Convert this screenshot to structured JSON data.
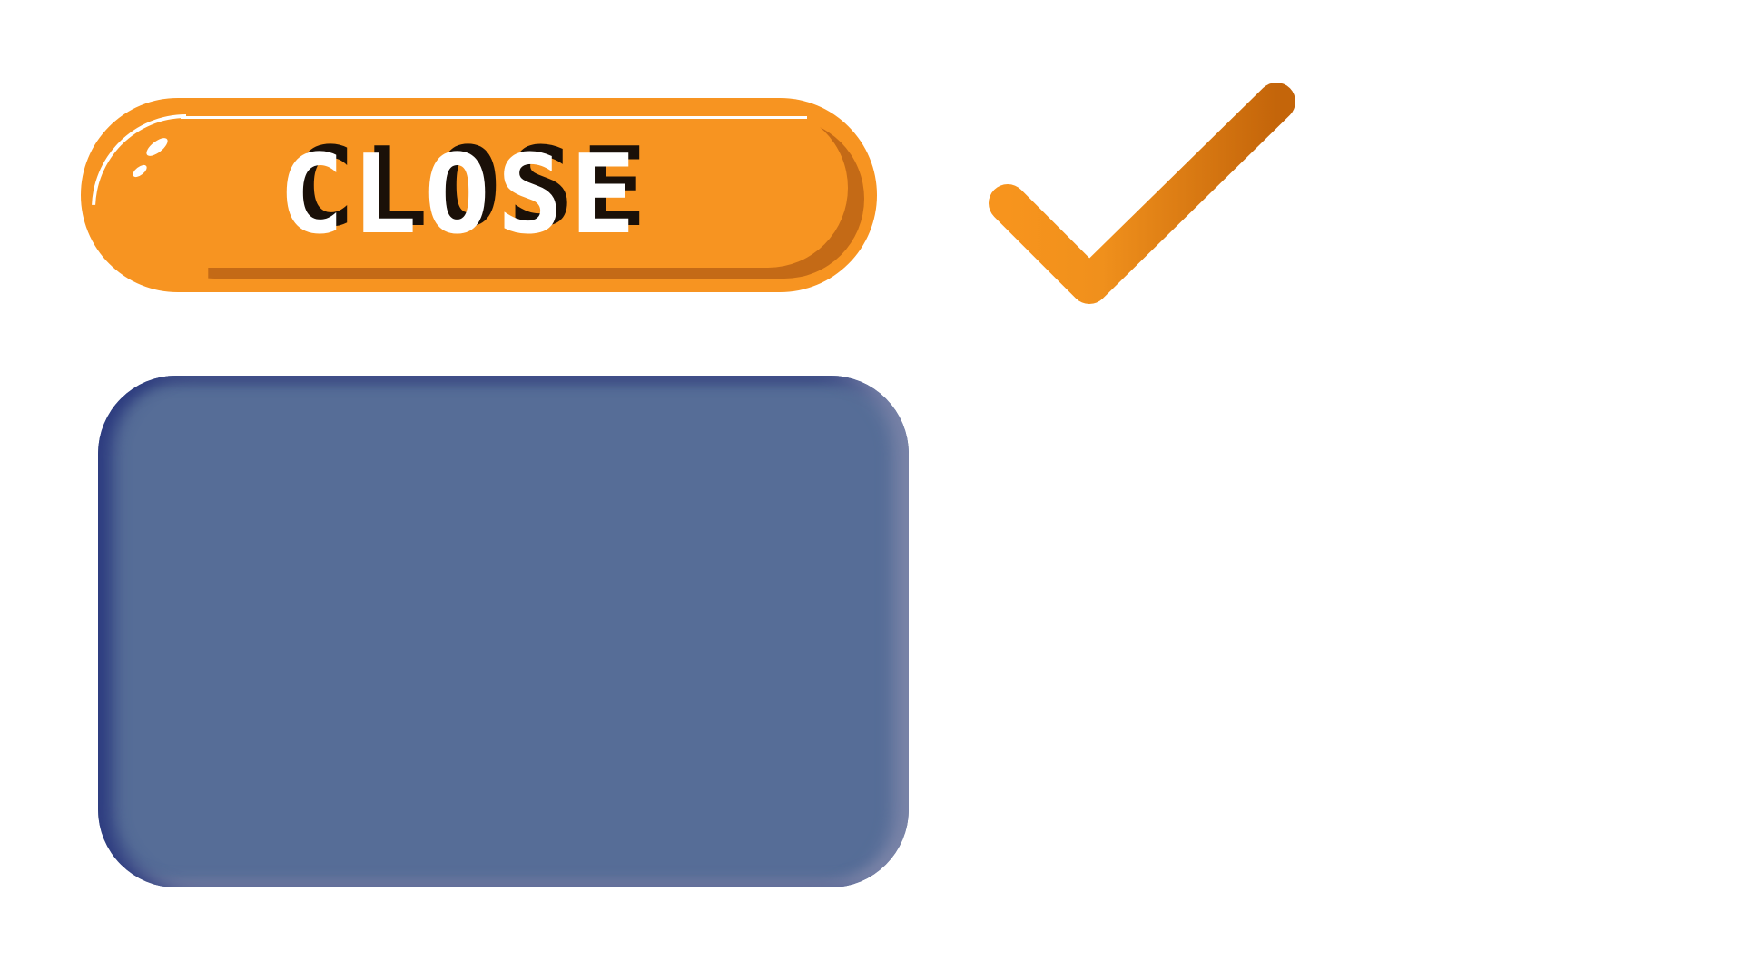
{
  "close_button": {
    "label": "CLOSE"
  },
  "icons": {
    "check": "checkmark-icon"
  },
  "colors": {
    "button_orange": "#f79421",
    "button_shadow": "#c46a16",
    "check_start": "#f7941d",
    "check_end": "#c96a0a",
    "panel_blue": "#566d97"
  }
}
